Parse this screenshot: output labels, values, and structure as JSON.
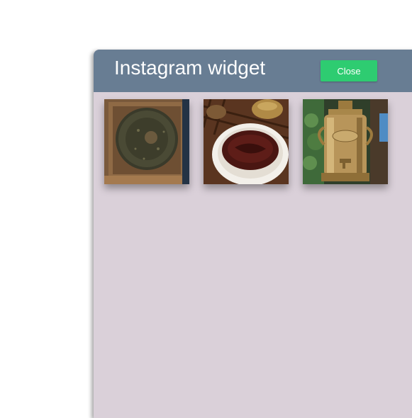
{
  "widget": {
    "title": "Instagram widget",
    "close_label": "Close",
    "accent_color": "#2ecc71",
    "header_color": "#687d93",
    "body_color": "#dad0d9"
  },
  "photos": [
    {
      "subject": "pu-erh tea cake on wooden tray"
    },
    {
      "subject": "bowl of dark tea on tea tray"
    },
    {
      "subject": "brass samovar"
    }
  ]
}
